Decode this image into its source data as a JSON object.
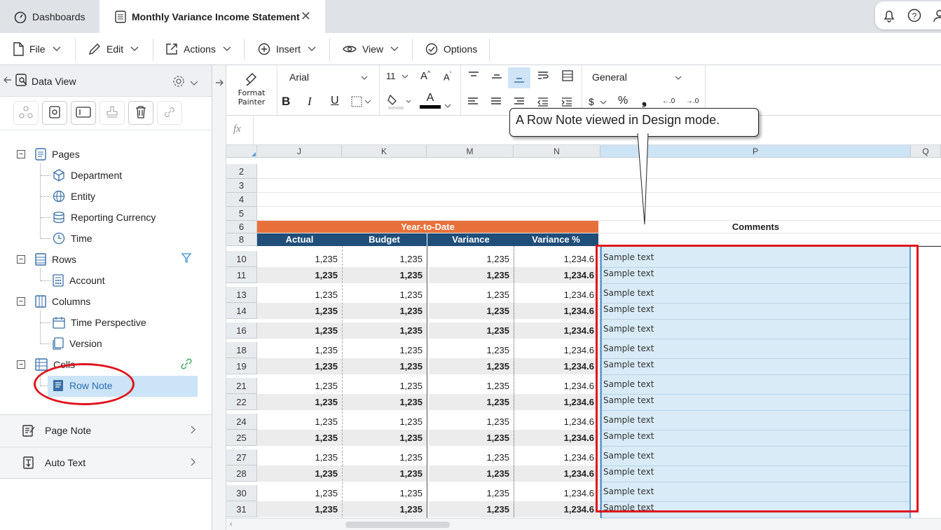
{
  "tabs": [
    {
      "label": "Dashboards",
      "icon": "dashboard-icon"
    },
    {
      "label": "Monthly Variance Income Statement",
      "icon": "report-icon",
      "close": "✕"
    }
  ],
  "menu": [
    {
      "label": "File",
      "icon": "file-icon"
    },
    {
      "label": "Edit",
      "icon": "pencil-icon"
    },
    {
      "label": "Actions",
      "icon": "export-icon"
    },
    {
      "label": "Insert",
      "icon": "plus-circle-icon"
    },
    {
      "label": "View",
      "icon": "eye-icon"
    },
    {
      "label": "Options",
      "icon": "check-circle-icon"
    }
  ],
  "panel": {
    "title": "Data View",
    "tree": {
      "pages": {
        "label": "Pages",
        "children": [
          "Department",
          "Entity",
          "Reporting Currency",
          "Time"
        ]
      },
      "rows": {
        "label": "Rows",
        "children": [
          "Account"
        ]
      },
      "columns": {
        "label": "Columns",
        "children": [
          "Time Perspective",
          "Version"
        ]
      },
      "cells": {
        "label": "Cells",
        "children": [
          "Row Note"
        ]
      }
    },
    "accordion": [
      {
        "label": "Page Note",
        "icon": "page-note-icon"
      },
      {
        "label": "Auto Text",
        "icon": "auto-text-icon"
      }
    ]
  },
  "ribbon": {
    "format_painter": "Format\nPainter",
    "font": "Arial",
    "size": "11",
    "number_format": "General",
    "grow": "A",
    "shrink": "A",
    "bold": "B",
    "italic": "I",
    "underline": "U",
    "color": "A",
    "dollar": "$",
    "percent": "%",
    "comma": "❟",
    "dec_less": "←.0",
    "dec_more": "→.0"
  },
  "formula": {
    "fx": "fx"
  },
  "grid": {
    "columns": [
      "J",
      "K",
      "M",
      "N",
      "P",
      "Q"
    ],
    "row_numbers": [
      "2",
      "3",
      "4",
      "5",
      "6",
      "8",
      "10",
      "11",
      "13",
      "14",
      "16",
      "18",
      "19",
      "21",
      "22",
      "24",
      "25",
      "27",
      "28",
      "30",
      "31"
    ],
    "header_group": "Year-to-Date",
    "headers": [
      "Actual",
      "Budget",
      "Variance",
      "Variance %"
    ],
    "comments_header": "Comments",
    "rows": [
      {
        "n": "10",
        "vals": [
          "1,235",
          "1,235",
          "1,235",
          "1,234.6"
        ],
        "bold": false,
        "note": "Sample text"
      },
      {
        "n": "11",
        "vals": [
          "1,235",
          "1,235",
          "1,235",
          "1,234.6"
        ],
        "bold": true,
        "note": "Sample text"
      },
      {
        "n": "13",
        "vals": [
          "1,235",
          "1,235",
          "1,235",
          "1,234.6"
        ],
        "bold": false,
        "note": "Sample text"
      },
      {
        "n": "14",
        "vals": [
          "1,235",
          "1,235",
          "1,235",
          "1,234.6"
        ],
        "bold": true,
        "note": "Sample text"
      },
      {
        "n": "16",
        "vals": [
          "1,235",
          "1,235",
          "1,235",
          "1,234.6"
        ],
        "bold": true,
        "note": "Sample text"
      },
      {
        "n": "18",
        "vals": [
          "1,235",
          "1,235",
          "1,235",
          "1,234.6"
        ],
        "bold": false,
        "note": "Sample text"
      },
      {
        "n": "19",
        "vals": [
          "1,235",
          "1,235",
          "1,235",
          "1,234.6"
        ],
        "bold": true,
        "note": "Sample text"
      },
      {
        "n": "21",
        "vals": [
          "1,235",
          "1,235",
          "1,235",
          "1,234.6"
        ],
        "bold": false,
        "note": "Sample text"
      },
      {
        "n": "22",
        "vals": [
          "1,235",
          "1,235",
          "1,235",
          "1,234.6"
        ],
        "bold": true,
        "note": "Sample text"
      },
      {
        "n": "24",
        "vals": [
          "1,235",
          "1,235",
          "1,235",
          "1,234.6"
        ],
        "bold": false,
        "note": "Sample text"
      },
      {
        "n": "25",
        "vals": [
          "1,235",
          "1,235",
          "1,235",
          "1,234.6"
        ],
        "bold": true,
        "note": "Sample text"
      },
      {
        "n": "27",
        "vals": [
          "1,235",
          "1,235",
          "1,235",
          "1,234.6"
        ],
        "bold": false,
        "note": "Sample text"
      },
      {
        "n": "28",
        "vals": [
          "1,235",
          "1,235",
          "1,235",
          "1,234.6"
        ],
        "bold": true,
        "note": "Sample text"
      },
      {
        "n": "30",
        "vals": [
          "1,235",
          "1,235",
          "1,235",
          "1,234.6"
        ],
        "bold": false,
        "note": "Sample text"
      },
      {
        "n": "31",
        "vals": [
          "1,235",
          "1,235",
          "1,235",
          "1,234.6"
        ],
        "bold": true,
        "note": "Sample text"
      }
    ]
  },
  "callout": "A Row Note viewed in Design mode.",
  "colors": {
    "orange": "#e8703a",
    "navy": "#1f4e79",
    "note_bg": "#d8ebf6",
    "highlight": "#e0141e"
  }
}
